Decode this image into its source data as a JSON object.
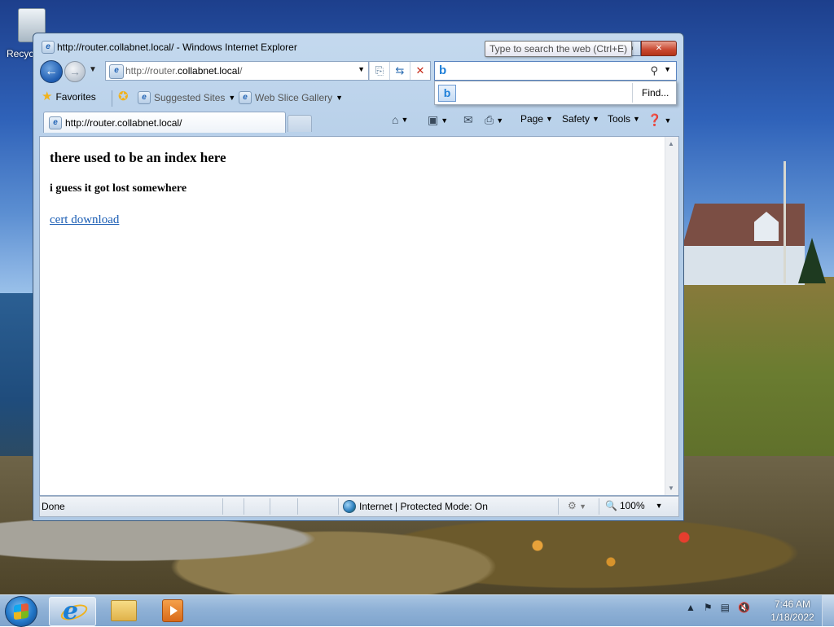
{
  "desktop": {
    "recycle_bin_label": "Recycle Bin"
  },
  "window": {
    "title": "http://router.collabnet.local/ - Windows Internet Explorer"
  },
  "nav": {
    "address_prefix": "http://router.",
    "address_domain": "collabnet.local",
    "address_suffix": "/"
  },
  "search": {
    "value": "",
    "tooltip": "Type to search the web (Ctrl+E)",
    "find_label": "Find..."
  },
  "favorites_bar": {
    "favorites_label": "Favorites",
    "suggested_sites_label": "Suggested Sites",
    "web_slice_gallery_label": "Web Slice Gallery"
  },
  "tab": {
    "label": "http://router.collabnet.local/"
  },
  "command_bar": {
    "page_label": "Page",
    "safety_label": "Safety",
    "tools_label": "Tools"
  },
  "page": {
    "heading": "there used to be an index here",
    "subheading": "i guess it got lost somewhere",
    "link_text": "cert download"
  },
  "status_bar": {
    "status": "Done",
    "zone": "Internet | Protected Mode: On",
    "zoom": "100%"
  },
  "taskbar": {
    "time": "7:46 AM",
    "date": "1/18/2022"
  }
}
